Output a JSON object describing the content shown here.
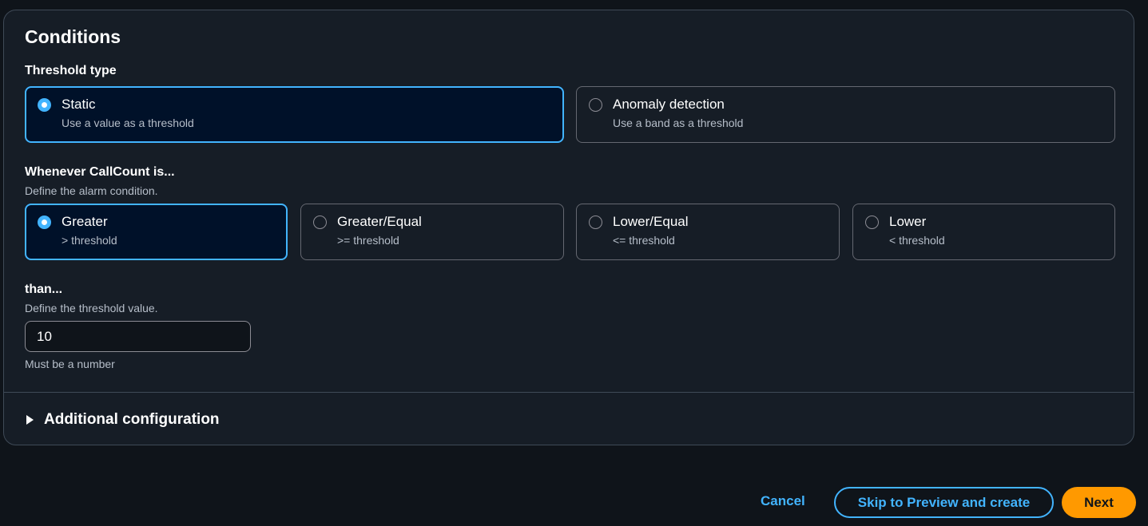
{
  "conditions": {
    "title": "Conditions",
    "threshold_type": {
      "label": "Threshold type",
      "options": [
        {
          "title": "Static",
          "subtitle": "Use a value as a threshold",
          "selected": true
        },
        {
          "title": "Anomaly detection",
          "subtitle": "Use a band as a threshold",
          "selected": false
        }
      ]
    },
    "whenever": {
      "label": "Whenever CallCount is...",
      "description": "Define the alarm condition.",
      "options": [
        {
          "title": "Greater",
          "subtitle": "> threshold",
          "selected": true
        },
        {
          "title": "Greater/Equal",
          "subtitle": ">= threshold",
          "selected": false
        },
        {
          "title": "Lower/Equal",
          "subtitle": "<= threshold",
          "selected": false
        },
        {
          "title": "Lower",
          "subtitle": "< threshold",
          "selected": false
        }
      ]
    },
    "than": {
      "label": "than...",
      "description": "Define the threshold value.",
      "value": "10",
      "hint": "Must be a number"
    },
    "additional": {
      "label": "Additional configuration",
      "icon": "caret-right-icon"
    }
  },
  "footer": {
    "cancel_label": "Cancel",
    "skip_label": "Skip to Preview and create",
    "next_label": "Next"
  },
  "colors": {
    "accent": "#42b4ff",
    "primary_button": "#ff9900",
    "selected_tile_bg": "#001129",
    "panel_bg": "#161d26",
    "page_bg": "#0f141a"
  }
}
